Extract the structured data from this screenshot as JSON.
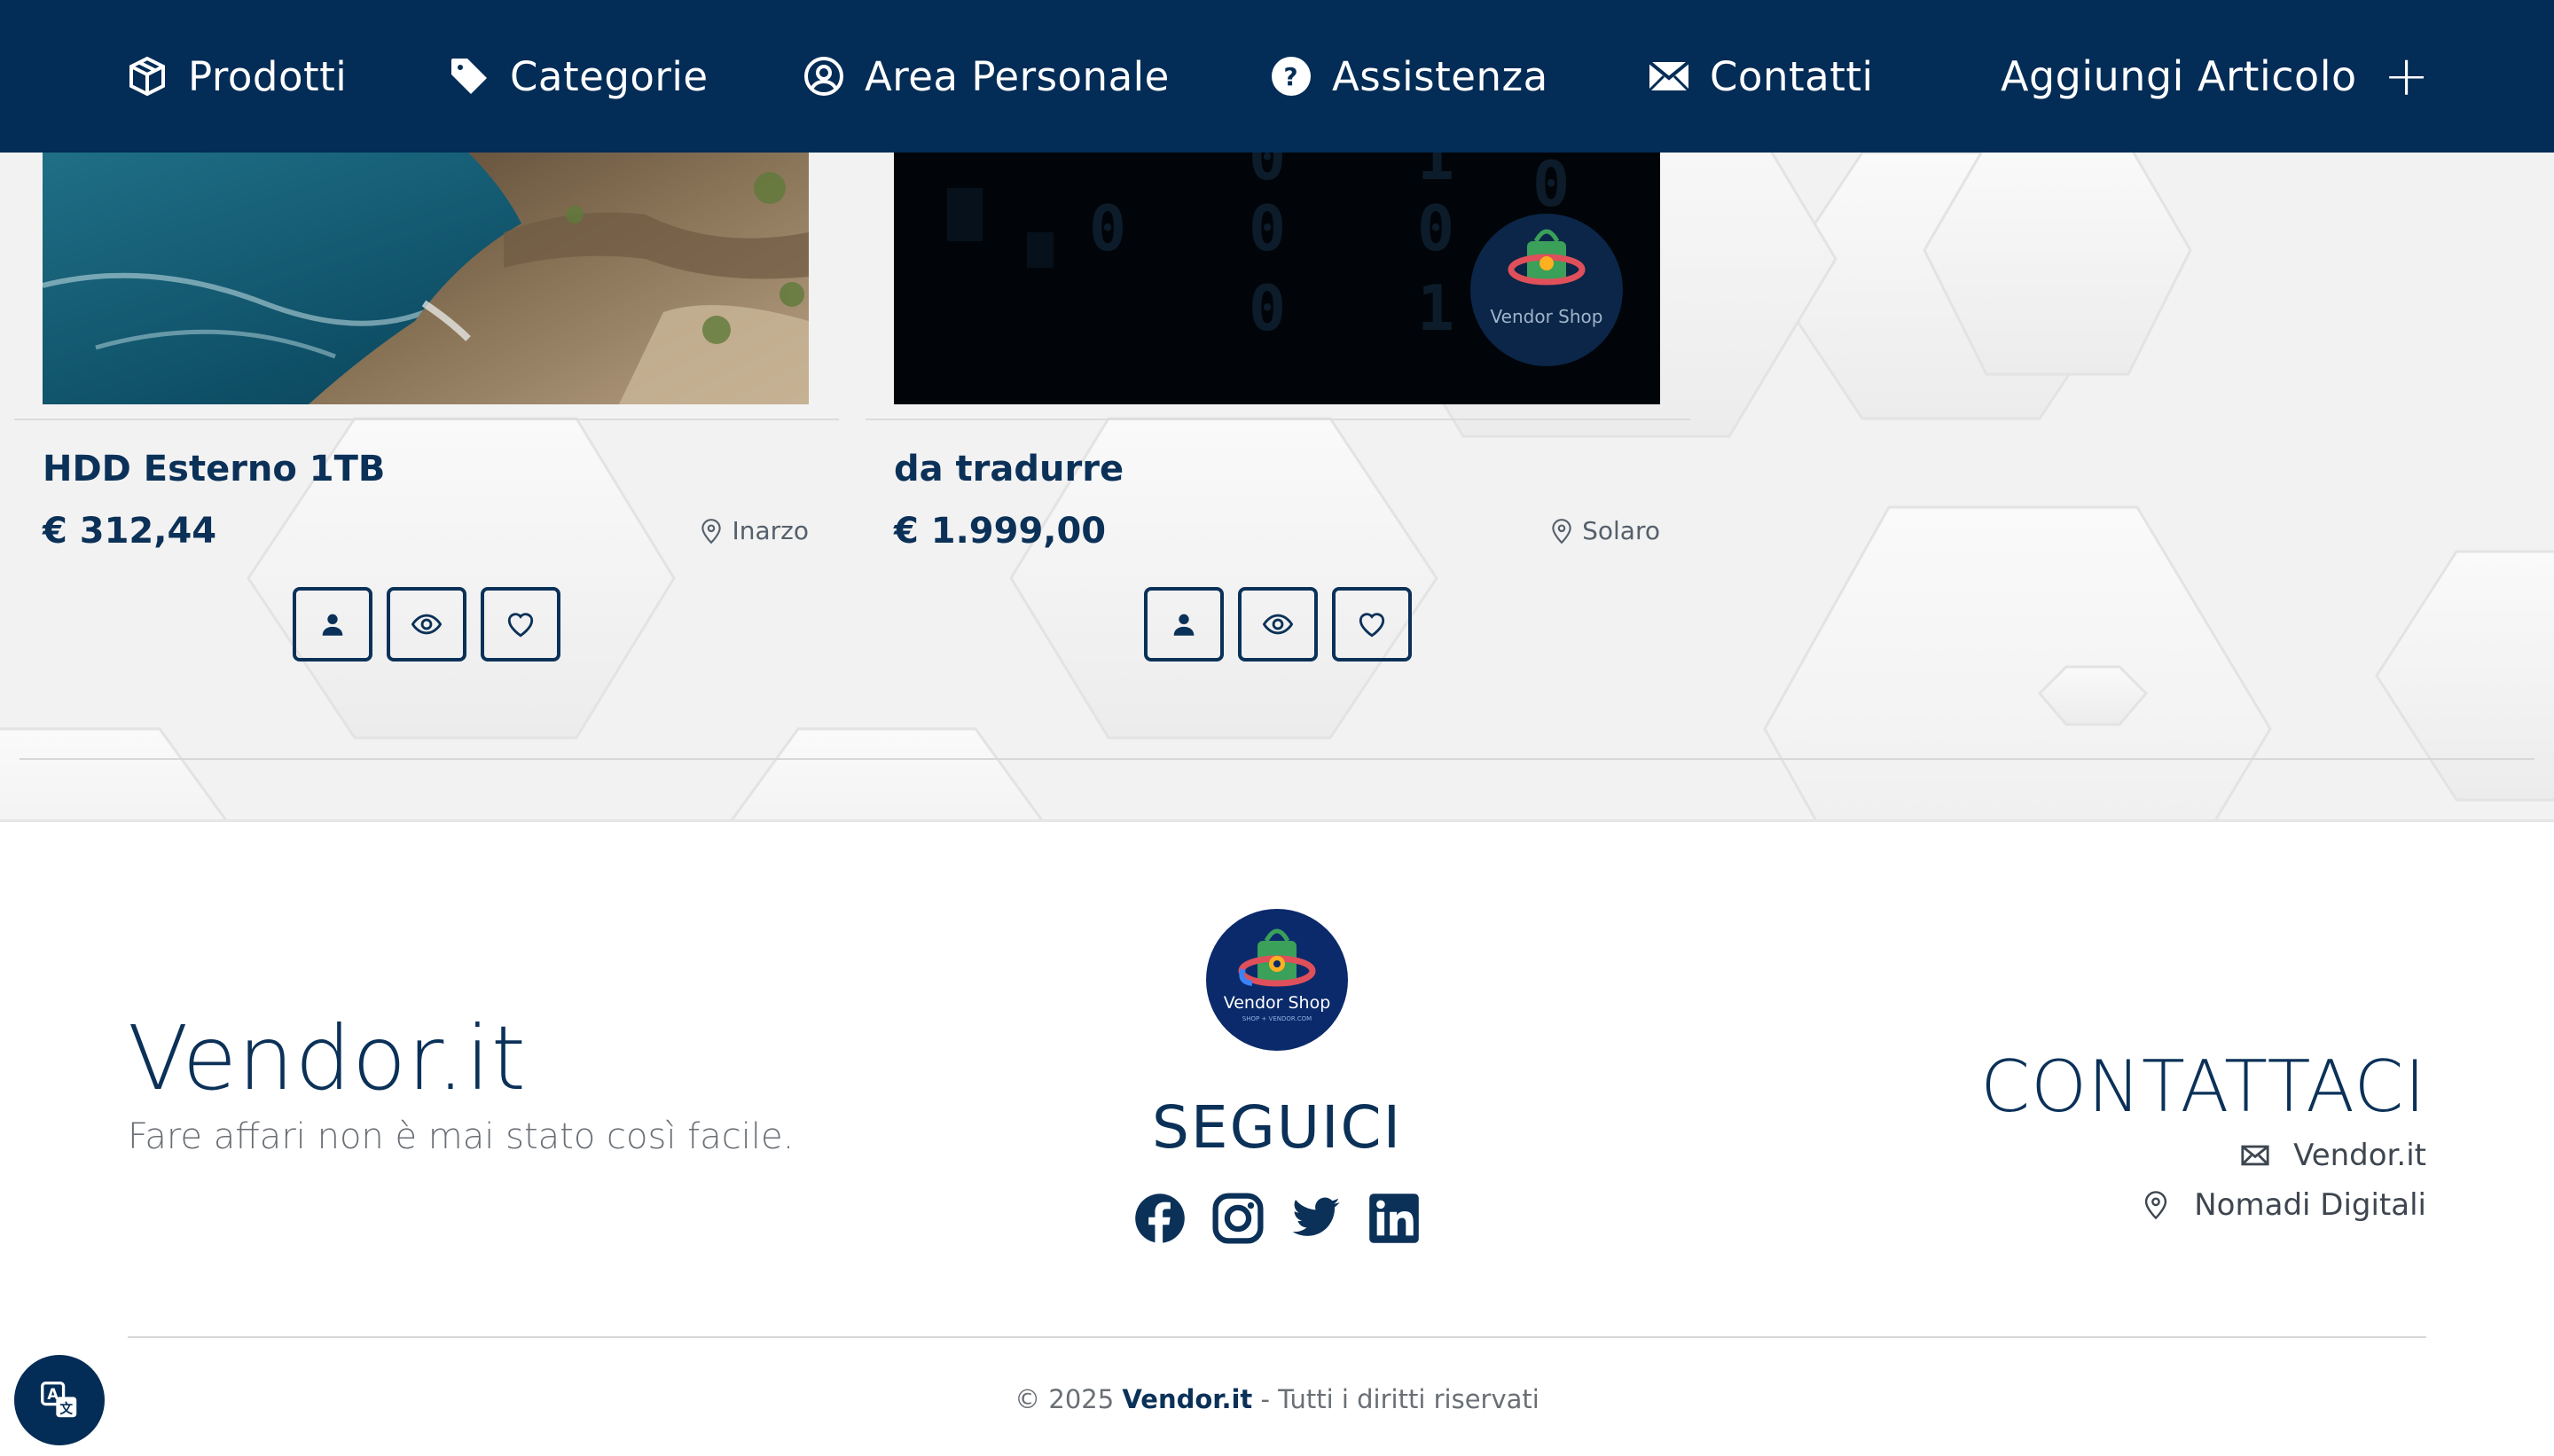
{
  "nav": {
    "items": [
      {
        "label": "Prodotti",
        "icon": "box-icon"
      },
      {
        "label": "Categorie",
        "icon": "tag-icon"
      },
      {
        "label": "Area Personale",
        "icon": "user-circle-icon"
      },
      {
        "label": "Assistenza",
        "icon": "question-circle-icon"
      },
      {
        "label": "Contatti",
        "icon": "envelope-icon"
      }
    ],
    "add_label": "Aggiungi Articolo",
    "add_symbol": "+"
  },
  "products": [
    {
      "title": "HDD Esterno 1TB",
      "price": "€ 312,44",
      "location": "Inarzo",
      "image": "sea-cliff-photo"
    },
    {
      "title": "da tradurre",
      "price": "€ 1.999,00",
      "location": "Solaro",
      "image": "binary-dark-with-logo"
    }
  ],
  "logo": {
    "name": "Vendor Shop",
    "sub": "SHOP + VENDOR.COM"
  },
  "footer": {
    "brand": "Vendor.it",
    "tagline": "Fare affari non è mai stato così facile.",
    "follow_title": "SEGUICI",
    "social": [
      "facebook-icon",
      "instagram-icon",
      "twitter-icon",
      "linkedin-icon"
    ],
    "contact_title": "CONTATTACI",
    "contact_email": "Vendor.it",
    "contact_address": "Nomadi Digitali",
    "copyright_prefix": "© 2025",
    "copyright_brand": "Vendor.it",
    "copyright_suffix": "- Tutti i diritti riservati"
  },
  "colors": {
    "primary": "#032c56",
    "text": "#0b3158",
    "muted": "#6a6f75",
    "background": "#f2f2f2"
  }
}
